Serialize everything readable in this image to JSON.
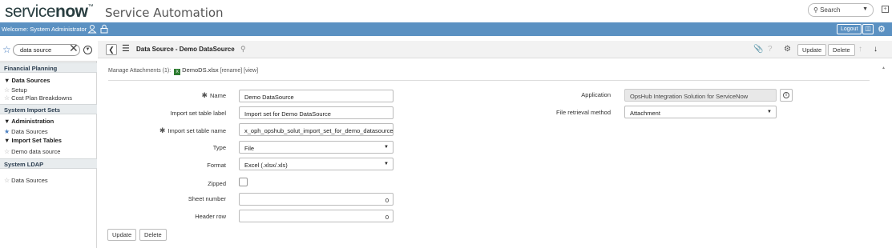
{
  "banner": {
    "logo_service": "service",
    "logo_now": "now",
    "logo_tm": "™",
    "title": "Service Automation",
    "search_placeholder": "Search"
  },
  "header": {
    "welcome": "Welcome: System Administrator",
    "logout": "Logout"
  },
  "sidebar": {
    "filter_value": "data source",
    "sections": [
      {
        "title": "Financial Planning"
      },
      {
        "title": "System Import Sets"
      },
      {
        "title": "System LDAP"
      }
    ],
    "financial": {
      "module": "Data Sources",
      "items": [
        "Setup",
        "Cost Plan Breakdowns"
      ]
    },
    "import": {
      "admin_module": "Administration",
      "admin_items": [
        "Data Sources"
      ],
      "tables_module": "Import Set Tables",
      "tables_items": [
        "Demo data source"
      ]
    },
    "ldap": {
      "items": [
        "Data Sources"
      ]
    }
  },
  "form": {
    "title": "Data Source - Demo DataSource",
    "update_label": "Update",
    "delete_label": "Delete",
    "attachments_label": "Manage Attachments (1):",
    "attachment_file": "DemoDS.xlsx",
    "rename_link": "[rename]",
    "view_link": "[view]",
    "fields": {
      "name_label": "Name",
      "name_value": "Demo DataSource",
      "import_label_label": "Import set table label",
      "import_label_value": "Import set for Demo DataSource",
      "import_name_label": "Import set table name",
      "import_name_value": "x_oph_opshub_solut_import_set_for_demo_datasource",
      "type_label": "Type",
      "type_value": "File",
      "format_label": "Format",
      "format_value": "Excel (.xlsx/.xls)",
      "zipped_label": "Zipped",
      "sheet_label": "Sheet number",
      "sheet_value": "0",
      "header_label": "Header row",
      "header_value": "0",
      "application_label": "Application",
      "application_value": "OpsHub Integration Solution for ServiceNow",
      "retrieval_label": "File retrieval method",
      "retrieval_value": "Attachment"
    }
  }
}
